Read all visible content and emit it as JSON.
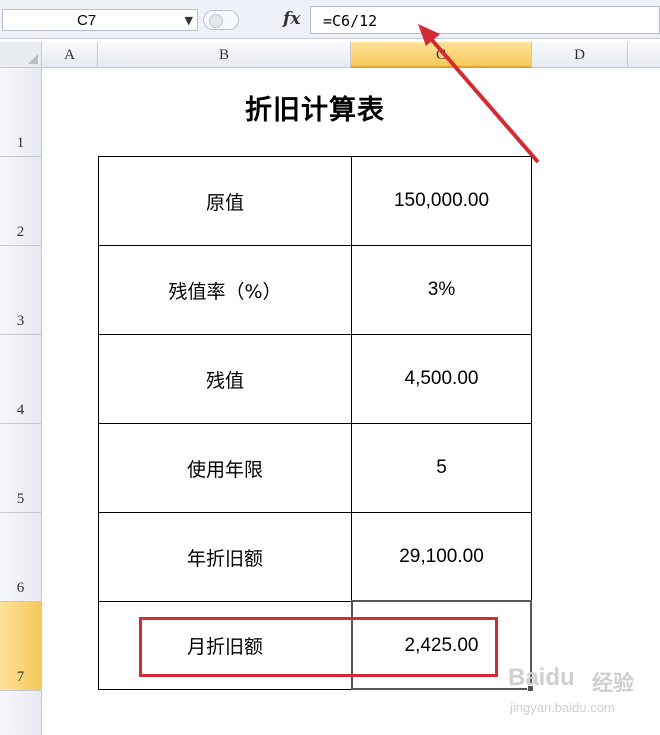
{
  "formula_bar": {
    "name_box": "C7",
    "fx_label": "fx",
    "formula": "=C6/12"
  },
  "columns": [
    "A",
    "B",
    "C",
    "D"
  ],
  "rows": [
    "1",
    "2",
    "3",
    "4",
    "5",
    "6",
    "7"
  ],
  "sheet": {
    "title": "折旧计算表",
    "table": [
      {
        "label": "原值",
        "value": "150,000.00"
      },
      {
        "label": "残值率（%）",
        "value": "3%"
      },
      {
        "label": "残值",
        "value": "4,500.00"
      },
      {
        "label": "使用年限",
        "value": "5"
      },
      {
        "label": "年折旧额",
        "value": "29,100.00"
      },
      {
        "label": "月折旧额",
        "value": "2,425.00"
      }
    ]
  },
  "watermark": {
    "brand": "Baidu",
    "cn": "经验",
    "url": "jingyan.baidu.com"
  },
  "colors": {
    "selection_header": "#f6c85a",
    "annotation_red": "#d42a33"
  }
}
